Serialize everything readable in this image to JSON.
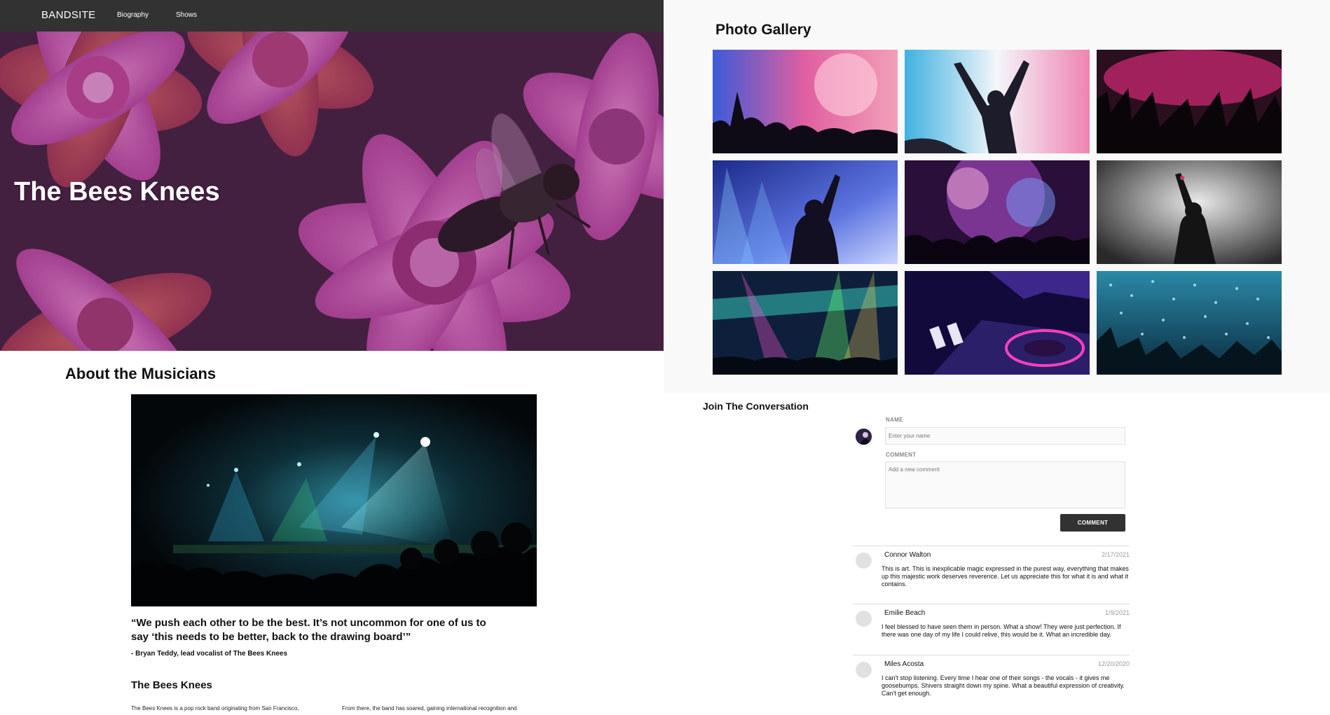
{
  "nav": {
    "brand": "BANDSITE",
    "links": [
      "Biography",
      "Shows"
    ]
  },
  "hero": {
    "title": "The Bees Knees"
  },
  "about": {
    "title": "About the Musicians",
    "quote": "“We push each other to be the best. It’s not uncommon for one of us to say ‘this needs to be better, back to the drawing board’”",
    "attribution": "- Bryan Teddy, lead vocalist of The Bees Knees",
    "bio_title": "The Bees Knees",
    "bio_p1": "The Bees Knees is a pop rock band originating from San Francisco,",
    "bio_p2": "From there, the band has soared, gaining international recognition and"
  },
  "gallery": {
    "title": "Photo Gallery",
    "photos": [
      "concert-crowd-pink-smoke",
      "dancer-arms-raised-blue-light",
      "hands-raised-magenta-stage",
      "silhouette-stage-lights-purple",
      "fireworks-crowd-neon",
      "singer-smoke-monochrome",
      "festival-crowd-rainbow-lasers",
      "dj-turntable-neon",
      "confetti-crowd-teal"
    ]
  },
  "conversation": {
    "title": "Join The Conversation",
    "name_label": "NAME",
    "name_placeholder": "Enter your name",
    "comment_label": "COMMENT",
    "comment_placeholder": "Add a new comment",
    "button_label": "COMMENT",
    "comments": [
      {
        "name": "Connor Walton",
        "date": "2/17/2021",
        "text": "This is art. This is inexplicable magic expressed in the purest way, everything that makes up this majestic work deserves reverence. Let us appreciate this for what it is and what it contains."
      },
      {
        "name": "Emilie Beach",
        "date": "1/9/2021",
        "text": "I feel blessed to have seen them in person. What a show! They were just perfection. If there was one day of my life I could relive, this would be it. What an incredible day."
      },
      {
        "name": "Miles Acosta",
        "date": "12/20/2020",
        "text": "I can't stop listening. Every time I hear one of their songs - the vocals - it gives me goosebumps. Shivers straight down my spine. What a beautiful expression of creativity. Can't get enough."
      }
    ]
  }
}
